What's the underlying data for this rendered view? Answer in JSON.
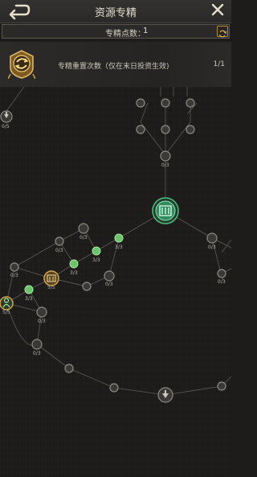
{
  "header": {
    "title": "资源专精",
    "back_icon": "back-arrow-icon",
    "close_icon": "close-icon"
  },
  "points": {
    "label": "专精点数：",
    "value": "1",
    "refresh_icon": "refresh-icon"
  },
  "special": {
    "icon": "gold-emblem-icon",
    "description": "专精重置次数（仅在末日投资生效)",
    "count": "1/1"
  },
  "colors": {
    "active": "#6bc46b",
    "inactive": "#3a3937",
    "key_node": "#2f8c5c",
    "gold": "#c9a24a"
  },
  "tree": {
    "labels": {
      "n_left_top": "0/5",
      "n_c_mid": "0/3",
      "n_r1": "0/3",
      "n_r2": "0/3",
      "n_a1": "3/3",
      "n_a2": "3/3",
      "n_a3": "3/3",
      "n_a4": "3/3",
      "n_main": "5/5",
      "n_d1": "0/3",
      "n_d2": "0/3",
      "n_d3": "0/3",
      "n_d4": "0/3",
      "n_left_active": "5/5",
      "n_e1": "0/3",
      "n_e2": "0/3"
    }
  }
}
